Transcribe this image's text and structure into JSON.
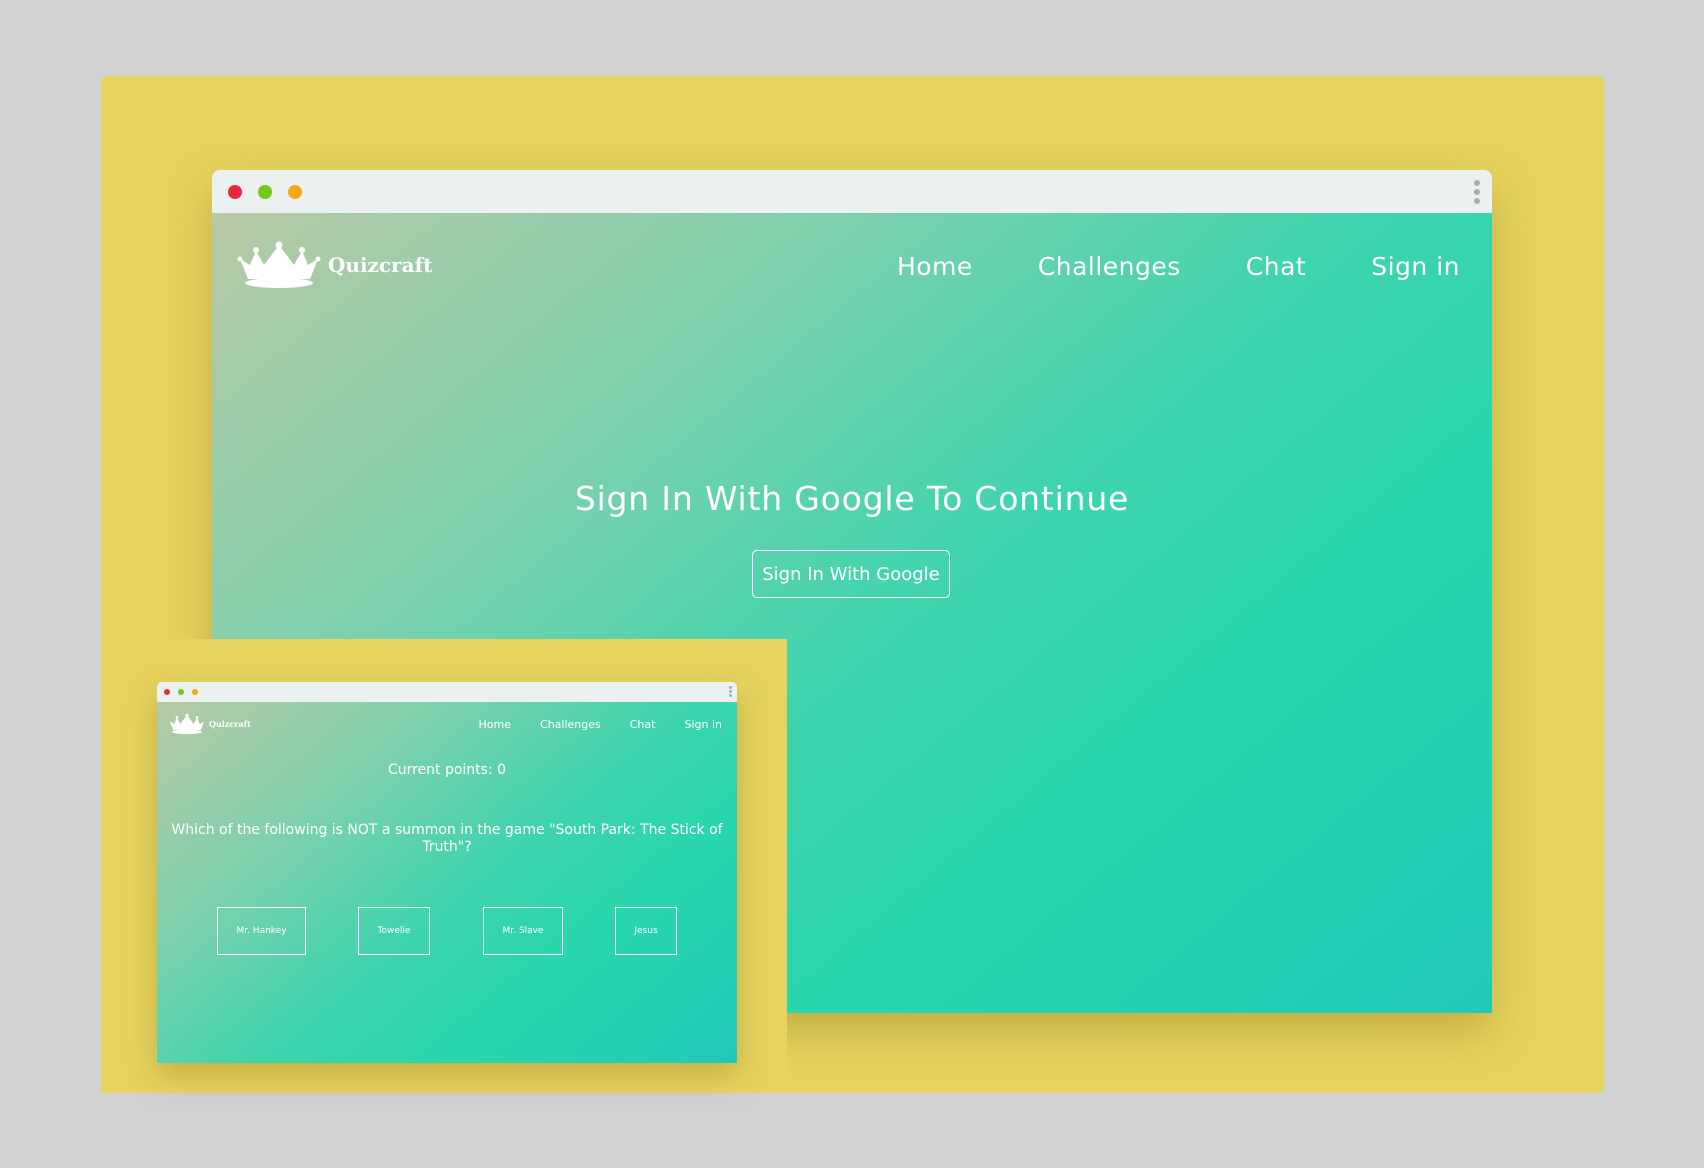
{
  "colors": {
    "backdrop": "#d2d2d2",
    "board": "#e7d45f",
    "titlebar": "#ebf0f0",
    "traffic_red": "#e8293b",
    "traffic_green": "#77c81e",
    "traffic_yellow": "#f5a90c",
    "gradient_start": "#b8c9a5",
    "gradient_mid": "#27d6ad",
    "gradient_end": "#23c8b8"
  },
  "main_window": {
    "brand": {
      "name": "Quizcraft",
      "logo_icon": "crown-icon"
    },
    "nav": {
      "home": "Home",
      "challenges": "Challenges",
      "chat": "Chat",
      "sign_in": "Sign in"
    },
    "hero": {
      "title": "Sign In With Google To Continue",
      "button": "Sign In With Google"
    }
  },
  "quiz_window": {
    "brand": {
      "name": "Quizcraft",
      "logo_icon": "crown-icon"
    },
    "nav": {
      "home": "Home",
      "challenges": "Challenges",
      "chat": "Chat",
      "sign_in": "Sign in"
    },
    "points_text": "Current points: 0",
    "question": "Which of the following is NOT a summon in the game \"South Park: The Stick of Truth\"?",
    "answers": [
      "Mr. Hankey",
      "Towelie",
      "Mr. Slave",
      "Jesus"
    ]
  }
}
